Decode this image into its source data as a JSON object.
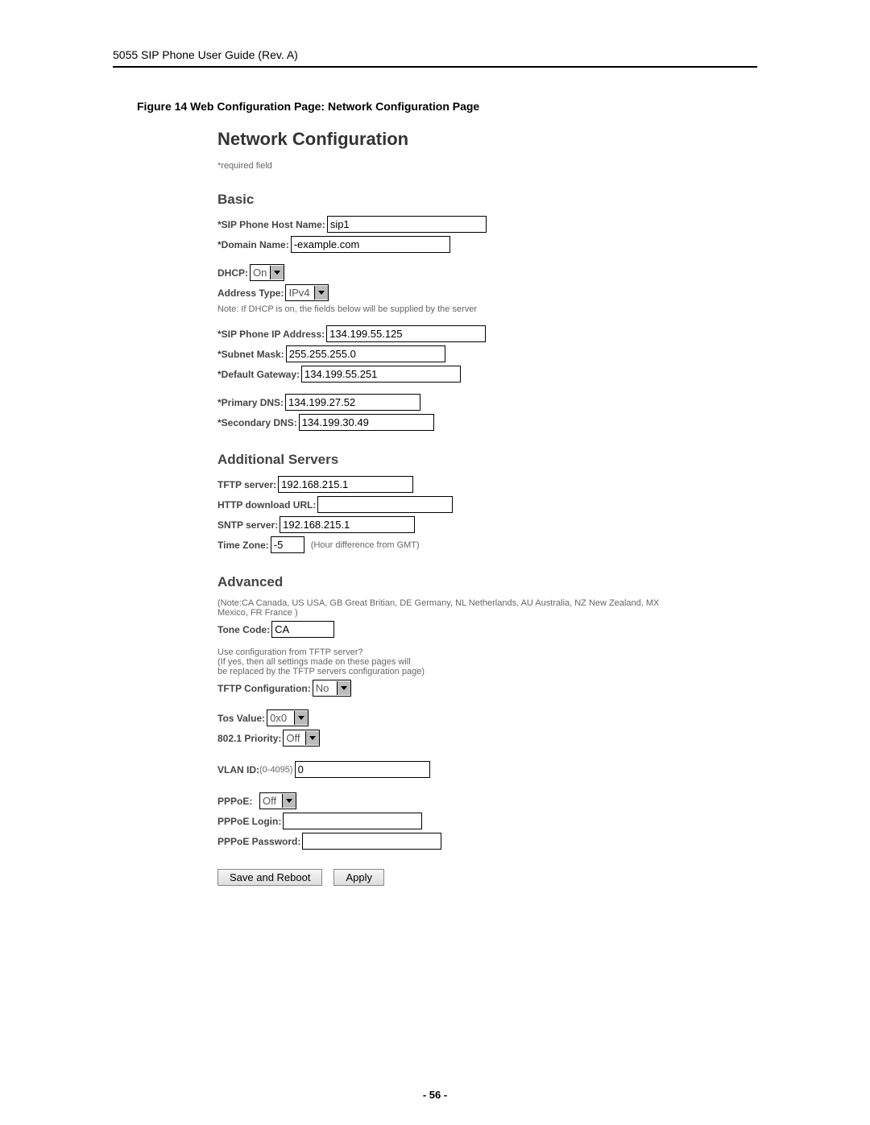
{
  "doc_header": "5055 SIP Phone User Guide (Rev. A)",
  "caption": "Figure 14   Web Configuration Page: Network Configuration Page",
  "panel": {
    "title": "Network Configuration",
    "required_note": "*required field",
    "basic": {
      "heading": "Basic",
      "host_label": "*SIP Phone Host Name:",
      "host_value": "sip1",
      "domain_label": "*Domain Name:",
      "domain_value": "-example.com",
      "dhcp_label": "DHCP:",
      "dhcp_value": "On",
      "addrtype_label": "Address Type:",
      "addrtype_value": "IPv4",
      "dhcp_note": "Note: If DHCP is on, the fields below will be supplied by the server",
      "ip_label": "*SIP Phone IP Address:",
      "ip_value": "134.199.55.125",
      "subnet_label": "*Subnet Mask:",
      "subnet_value": "255.255.255.0",
      "gateway_label": "*Default Gateway:",
      "gateway_value": "134.199.55.251",
      "pdns_label": "*Primary DNS:",
      "pdns_value": "134.199.27.52",
      "sdns_label": "*Secondary DNS:",
      "sdns_value": "134.199.30.49"
    },
    "servers": {
      "heading": "Additional Servers",
      "tftp_label": "TFTP server:",
      "tftp_value": "192.168.215.1",
      "http_label": "HTTP download URL:",
      "http_value": "",
      "sntp_label": "SNTP server:",
      "sntp_value": "192.168.215.1",
      "tz_label": "Time Zone:",
      "tz_value": "-5",
      "tz_trailing": "(Hour difference from GMT)"
    },
    "advanced": {
      "heading": "Advanced",
      "tone_note": "(Note:CA Canada, US USA, GB Great Britian, DE Germany, NL Netherlands, AU Australia, NZ New Zealand, MX Mexico, FR France )",
      "tone_label": "Tone Code:",
      "tone_value": "CA",
      "tftpcfg_q": "Use configuration from TFTP server?",
      "tftpcfg_note1": "(If yes, then all settings made on these pages will",
      "tftpcfg_note2": "be replaced by the TFTP servers configuration page)",
      "tftpcfg_label": "TFTP Configuration:",
      "tftpcfg_value": "No",
      "tos_label": "Tos Value:",
      "tos_value": "0x0",
      "p8021_label": "802.1 Priority:",
      "p8021_value": "Off",
      "vlan_label": "VLAN ID:",
      "vlan_range": "(0-4095)",
      "vlan_value": "0",
      "pppoe_label": "PPPoE:",
      "pppoe_value": "Off",
      "pppoe_login_label": "PPPoE Login:",
      "pppoe_login_value": "",
      "pppoe_pw_label": "PPPoE Password:",
      "pppoe_pw_value": ""
    },
    "buttons": {
      "save": "Save and Reboot",
      "apply": "Apply"
    }
  },
  "page_number": "- 56 -"
}
